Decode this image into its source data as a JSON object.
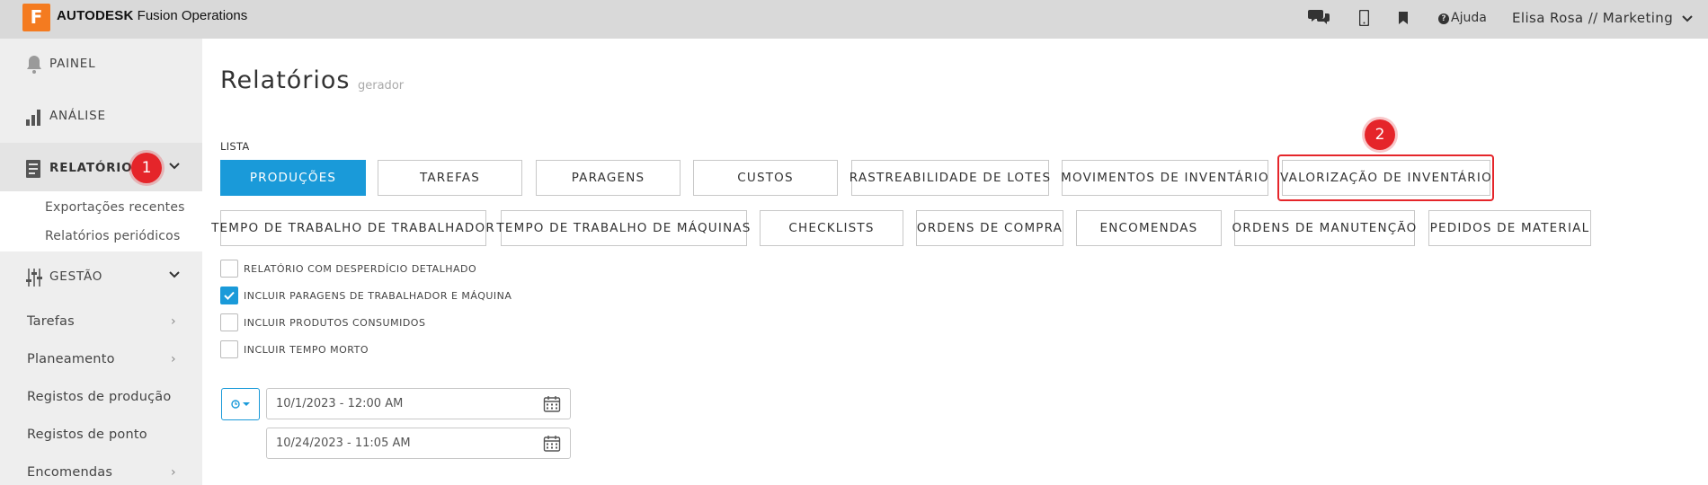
{
  "header": {
    "logo_letter": "F",
    "brand_bold": "AUTODESK",
    "brand_product": "Fusion Operations",
    "help_label": "Ajuda",
    "user_label": "Elisa Rosa // Marketing"
  },
  "sidebar": {
    "painel": "PAINEL",
    "analise": "ANÁLISE",
    "relatorios": "RELATÓRIOS",
    "relatorios_sub": [
      "Exportações recentes",
      "Relatórios periódicos"
    ],
    "gestao": "GESTÃO",
    "items": [
      "Tarefas",
      "Planeamento",
      "Registos de produção",
      "Registos de ponto",
      "Encomendas"
    ]
  },
  "annotations": {
    "badge1": "1",
    "badge2": "2"
  },
  "page": {
    "title": "Relatórios",
    "subtitle": "gerador",
    "list_label": "LISTA"
  },
  "report_buttons_row1": [
    "PRODUÇÕES",
    "TAREFAS",
    "PARAGENS",
    "CUSTOS",
    "RASTREABILIDADE DE LOTES",
    "MOVIMENTOS DE INVENTÁRIO",
    "VALORIZAÇÃO DE INVENTÁRIO"
  ],
  "report_buttons_row2": [
    "TEMPO DE TRABALHO DE TRABALHADOR",
    "TEMPO DE TRABALHO DE MÁQUINAS",
    "CHECKLISTS",
    "ORDENS DE COMPRA",
    "ENCOMENDAS",
    "ORDENS DE MANUTENÇÃO",
    "PEDIDOS DE MATERIAL"
  ],
  "selected_report": "PRODUÇÕES",
  "options": [
    {
      "label": "RELATÓRIO COM DESPERDÍCIO DETALHADO",
      "checked": false
    },
    {
      "label": "INCLUIR PARAGENS DE TRABALHADOR E MÁQUINA",
      "checked": true
    },
    {
      "label": "INCLUIR PRODUTOS CONSUMIDOS",
      "checked": false
    },
    {
      "label": "INCLUIR TEMPO MORTO",
      "checked": false
    }
  ],
  "date_range": {
    "start": "10/1/2023 - 12:00 AM",
    "end": "10/24/2023 - 11:05 AM"
  },
  "colors": {
    "accent": "#1a9ad9",
    "annotation": "#e5252a",
    "brand": "#f47b20"
  }
}
